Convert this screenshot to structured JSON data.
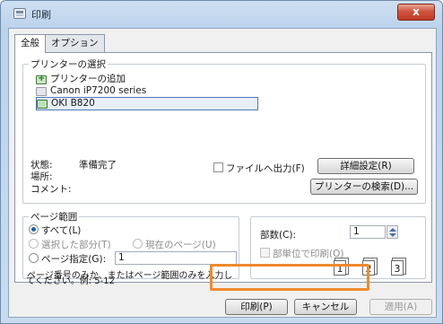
{
  "window": {
    "title": "印刷",
    "close_label": "x"
  },
  "tabs": [
    {
      "label": "全般",
      "active": true
    },
    {
      "label": "オプション",
      "active": false
    }
  ],
  "printer_group": {
    "label": "プリンターの選択",
    "items": [
      {
        "label": "プリンターの追加",
        "icon": "add-printer-icon"
      },
      {
        "label": "Canon iP7200 series",
        "icon": "printer-icon"
      },
      {
        "label": "OKI B820",
        "icon": "printer-ok-icon",
        "selected": true
      }
    ]
  },
  "status": {
    "state_label": "状態:",
    "state_value": "準備完了",
    "location_label": "場所:",
    "comment_label": "コメント:",
    "print_to_file_label": "ファイルへ出力(F)",
    "preferences_button": "詳細設定(R)",
    "find_printer_button": "プリンターの検索(D)..."
  },
  "page_range": {
    "label": "ページ範囲",
    "all_label": "すべて(L)",
    "selection_label": "選択した部分(T)",
    "current_page_label": "現在のページ(U)",
    "pages_label": "ページ指定(G):",
    "pages_value": "1",
    "hint_line1": "ページ番号のみか、またはページ範囲のみを入力し",
    "hint_line2": "てください。例: 5-12"
  },
  "copies": {
    "label": "部数(C):",
    "value": "1",
    "collate_label": "部単位で印刷(O)",
    "pages": [
      "1",
      "1",
      "2",
      "2",
      "3",
      "3"
    ]
  },
  "footer": {
    "print_button": "印刷(P)",
    "cancel_button": "キャンセル",
    "apply_button": "適用(A)"
  },
  "colors": {
    "highlight": "#ef8a2e",
    "close": "#c03a22",
    "selected_border": "#4f79b6"
  }
}
